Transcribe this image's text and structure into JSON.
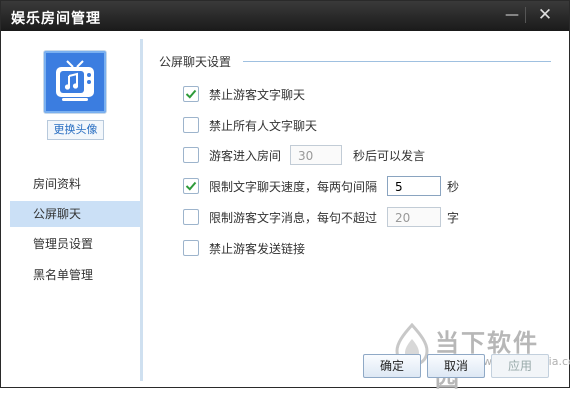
{
  "window": {
    "title": "娱乐房间管理",
    "minimize_glyph": "—",
    "close_glyph": "✕"
  },
  "sidebar": {
    "avatar_icon": "tv-music-icon",
    "change_avatar_label": "更换头像",
    "items": [
      {
        "label": "房间资料",
        "active": false
      },
      {
        "label": "公屏聊天",
        "active": true
      },
      {
        "label": "管理员设置",
        "active": false
      },
      {
        "label": "黑名单管理",
        "active": false
      }
    ]
  },
  "section": {
    "title": "公屏聊天设置"
  },
  "options": [
    {
      "label": "禁止游客文字聊天",
      "checked": true
    },
    {
      "label": "禁止所有人文字聊天",
      "checked": false
    },
    {
      "label": "游客进入房间",
      "checked": false,
      "value": "30",
      "suffix": "秒后可以发言"
    },
    {
      "label": "限制文字聊天速度，每两句间隔",
      "checked": true,
      "value": "5",
      "suffix": "秒"
    },
    {
      "label": "限制游客文字消息，每句不超过",
      "checked": false,
      "value": "20",
      "suffix": "字"
    },
    {
      "label": "禁止游客发送链接",
      "checked": false
    }
  ],
  "buttons": {
    "ok": "确定",
    "cancel": "取消",
    "apply": "应用"
  },
  "watermark": {
    "title": "当下软件园",
    "url": "www.downxia.com"
  },
  "colors": {
    "accent": "#3b7de0",
    "selected_bg": "#cbe0f6",
    "check": "#2e9b3a"
  }
}
